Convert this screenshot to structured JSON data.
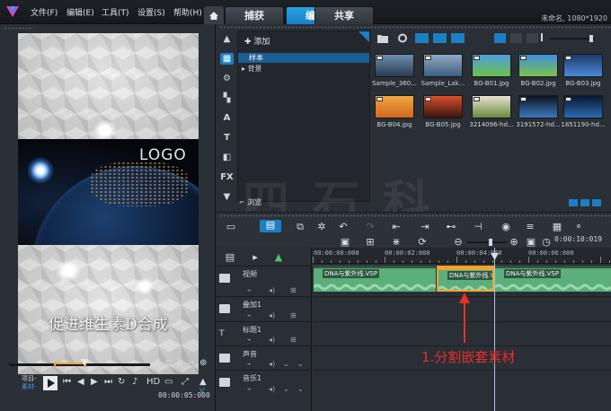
{
  "menu": {
    "items": [
      "文件(F)",
      "编辑(E)",
      "工具(T)",
      "设置(S)",
      "帮助(H)"
    ],
    "tabs": [
      "捕获",
      "编辑",
      "共享"
    ],
    "active_tab": "编辑",
    "window_title": "未命名, 1080*1920"
  },
  "preview": {
    "logo_text": "LOGO",
    "caption": "促进维生素D合成"
  },
  "player": {
    "project_label": "项目-",
    "clip_label": "素材-",
    "timecode": "00:00:05:000"
  },
  "library": {
    "add_label": "添加",
    "folders": [
      "样本",
      "背景"
    ],
    "selected_folder": "样本",
    "browse_label": "浏览",
    "thumbnails": [
      {
        "label": "Sample_360...",
        "c1": "#6d8fb0",
        "c2": "#2a3a55"
      },
      {
        "label": "Sample_Lak...",
        "c1": "#8fa9c4",
        "c2": "#3d5f7e"
      },
      {
        "label": "BG-B01.jpg",
        "c1": "#4f9de0",
        "c2": "#6cc04a"
      },
      {
        "label": "BG-B02.jpg",
        "c1": "#3f8fe0",
        "c2": "#7cc14a"
      },
      {
        "label": "BG-B03.jpg",
        "c1": "#1f3a6a",
        "c2": "#4a8ad8"
      },
      {
        "label": "BG-B04.jpg",
        "c1": "#f0a640",
        "c2": "#d06820"
      },
      {
        "label": "BG-B05.jpg",
        "c1": "#d8502a",
        "c2": "#3a1410"
      },
      {
        "label": "3214096-hd...",
        "c1": "#e8e0d0",
        "c2": "#6a8a40"
      },
      {
        "label": "3191572-hd...",
        "c1": "#0e1420",
        "c2": "#3a78c0"
      },
      {
        "label": "1851190-hd...",
        "c1": "#0a1830",
        "c2": "#2a6ab0"
      }
    ]
  },
  "timeline": {
    "time_display": "0:00:10:019",
    "ruler": [
      "00:00:00:000",
      "00:00:02:000",
      "00:00:04:000",
      "00:00:06:000"
    ],
    "tracks": [
      "视频",
      "叠加1",
      "标题1",
      "声音",
      "音乐1"
    ],
    "clips": [
      {
        "name": "DNA与紫外线.VSP"
      },
      {
        "name": "DNA与紫外线.VSP"
      },
      {
        "name": "DNA与紫外线.VSP"
      }
    ],
    "annotation": "1.分割嵌套素材"
  },
  "colors": {
    "accent": "#1c7fc4",
    "clip": "#5cae7a",
    "annotation": "#e6302c",
    "selection": "#f3a32e"
  }
}
